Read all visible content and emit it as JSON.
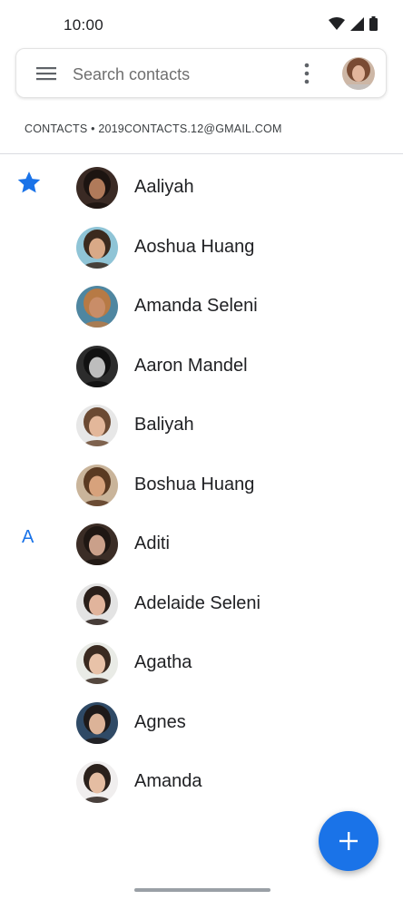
{
  "status_bar": {
    "time": "10:00"
  },
  "search": {
    "placeholder": "Search contacts"
  },
  "account": {
    "line": "CONTACTS • 2019CONTACTS.12@GMAIL.COM"
  },
  "colors": {
    "accent": "#1a73e8",
    "divider": "#dadce0"
  },
  "contacts": [
    {
      "section": "star",
      "name": "Aaliyah",
      "avatar": {
        "bg": "#3a2a24",
        "skin": "#b07a5a",
        "hair": "#1c1411"
      }
    },
    {
      "section": "",
      "name": "Aoshua Huang",
      "avatar": {
        "bg": "#8fc4d6",
        "skin": "#d9a987",
        "hair": "#3b2a1e"
      }
    },
    {
      "section": "",
      "name": "Amanda Seleni",
      "avatar": {
        "bg": "#4f86a0",
        "skin": "#c98d68",
        "hair": "#b77a45"
      }
    },
    {
      "section": "",
      "name": "Aaron Mandel",
      "avatar": {
        "bg": "#2c2c2c",
        "skin": "#bdbdbd",
        "hair": "#111111"
      }
    },
    {
      "section": "",
      "name": "Baliyah",
      "avatar": {
        "bg": "#e7e7e7",
        "skin": "#e3b79a",
        "hair": "#6b4a33"
      }
    },
    {
      "section": "",
      "name": "Boshua Huang",
      "avatar": {
        "bg": "#c9b49a",
        "skin": "#d7a27c",
        "hair": "#5a3a22"
      }
    },
    {
      "section": "A",
      "name": "Aditi",
      "avatar": {
        "bg": "#3b2d26",
        "skin": "#caa08a",
        "hair": "#1f1713"
      }
    },
    {
      "section": "",
      "name": "Adelaide Seleni",
      "avatar": {
        "bg": "#e3e3e3",
        "skin": "#e1b49c",
        "hair": "#2a1f1a"
      }
    },
    {
      "section": "",
      "name": "Agatha",
      "avatar": {
        "bg": "#e9ebe6",
        "skin": "#e8c2a8",
        "hair": "#3a2a20"
      }
    },
    {
      "section": "",
      "name": "Agnes",
      "avatar": {
        "bg": "#2f4a66",
        "skin": "#dcb398",
        "hair": "#1e1a1a"
      }
    },
    {
      "section": "",
      "name": "Amanda",
      "avatar": {
        "bg": "#f0eeee",
        "skin": "#e5bda2",
        "hair": "#2b211c"
      }
    }
  ],
  "fab": {
    "icon": "plus-icon"
  }
}
